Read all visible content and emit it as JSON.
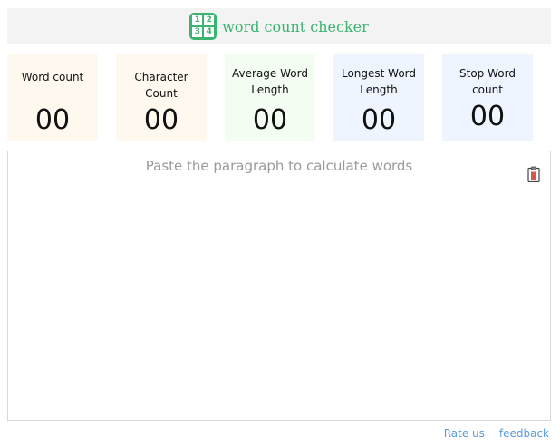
{
  "header": {
    "title": "word count checker",
    "logo_digits": [
      "1",
      "2",
      "3",
      "4"
    ],
    "accent_color": "#3cb371"
  },
  "stats": [
    {
      "label": "Word count",
      "value": "00",
      "bg": "#fff8ef"
    },
    {
      "label": "Character Count",
      "value": "00",
      "bg": "#fff8ef"
    },
    {
      "label": "Average Word Length",
      "value": "00",
      "bg": "#f3fdf1"
    },
    {
      "label": "Longest Word Length",
      "value": "00",
      "bg": "#eef5fe"
    },
    {
      "label": "Stop Word count",
      "value": "00",
      "bg": "#eef5fe"
    }
  ],
  "editor": {
    "value": "",
    "placeholder": "Paste the paragraph to calculate words",
    "clear_icon": "clipboard-icon"
  },
  "footer": {
    "rate_label": "Rate us",
    "feedback_label": "feedback"
  }
}
